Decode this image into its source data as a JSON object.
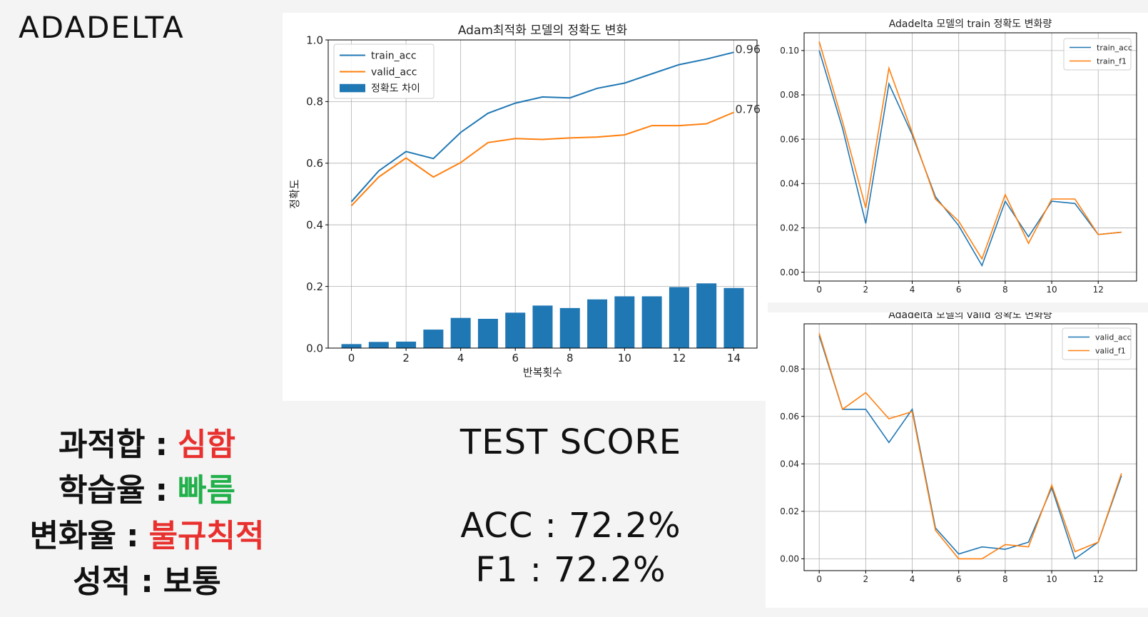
{
  "slide": {
    "title": "ADADELTA"
  },
  "summary": [
    {
      "label": "과적합",
      "value": "심함",
      "color": "#e8312f"
    },
    {
      "label": "학습율",
      "value": "빠름",
      "color": "#22b04b"
    },
    {
      "label": "변화율",
      "value": "불규칙적",
      "color": "#e8312f"
    },
    {
      "label": "성적",
      "value": "보통",
      "color": "#111111"
    }
  ],
  "test_score": {
    "title": "TEST SCORE",
    "acc_label": "ACC",
    "acc_value": "72.2%",
    "f1_label": "F1",
    "f1_value": "72.2%"
  },
  "chart_data": [
    {
      "type": "line",
      "title": "Adam최적화 모델의 정확도 변화",
      "xlabel": "반복횟수",
      "ylabel": "정확도",
      "x": [
        0,
        1,
        2,
        3,
        4,
        5,
        6,
        7,
        8,
        9,
        10,
        11,
        12,
        13,
        14
      ],
      "xticks": [
        0,
        2,
        4,
        6,
        8,
        10,
        12,
        14
      ],
      "yticks": [
        "0.0",
        "0.2",
        "0.4",
        "0.6",
        "0.8",
        "1.0"
      ],
      "ylim": [
        0,
        1.0
      ],
      "grid": true,
      "legend": "top-left",
      "series": [
        {
          "name": "train_acc",
          "kind": "line",
          "color": "#1f77b4",
          "values": [
            0.475,
            0.575,
            0.638,
            0.615,
            0.7,
            0.762,
            0.795,
            0.815,
            0.812,
            0.843,
            0.86,
            0.89,
            0.92,
            0.938,
            0.96
          ]
        },
        {
          "name": "valid_acc",
          "kind": "line",
          "color": "#ff7f0e",
          "values": [
            0.462,
            0.555,
            0.617,
            0.555,
            0.602,
            0.667,
            0.68,
            0.677,
            0.682,
            0.685,
            0.692,
            0.722,
            0.722,
            0.728,
            0.765
          ]
        },
        {
          "name": "정확도 차이",
          "kind": "bar",
          "color": "#1f77b4",
          "values": [
            0.013,
            0.02,
            0.021,
            0.06,
            0.098,
            0.095,
            0.115,
            0.138,
            0.13,
            0.158,
            0.168,
            0.168,
            0.198,
            0.21,
            0.195
          ]
        }
      ],
      "annotations": [
        {
          "text": "0.96",
          "x": 14,
          "y": 0.96
        },
        {
          "text": "0.76",
          "x": 14,
          "y": 0.765
        }
      ]
    },
    {
      "type": "line",
      "title": "Adadelta 모델의 train 정확도 변화량",
      "x": [
        0,
        1,
        2,
        3,
        4,
        5,
        6,
        7,
        8,
        9,
        10,
        11,
        12,
        13
      ],
      "xticks": [
        0,
        2,
        4,
        6,
        8,
        10,
        12
      ],
      "yticks": [
        "0.00",
        "0.02",
        "0.04",
        "0.06",
        "0.08",
        "0.10"
      ],
      "ylim": [
        -0.004,
        0.108
      ],
      "grid": true,
      "legend": "top-right",
      "series": [
        {
          "name": "train_acc",
          "color": "#1f77b4",
          "values": [
            0.1,
            0.065,
            0.022,
            0.085,
            0.062,
            0.034,
            0.021,
            0.003,
            0.032,
            0.016,
            0.032,
            0.031,
            0.017,
            0.018
          ]
        },
        {
          "name": "train_f1",
          "color": "#ff7f0e",
          "values": [
            0.104,
            0.068,
            0.029,
            0.092,
            0.063,
            0.033,
            0.023,
            0.006,
            0.035,
            0.013,
            0.033,
            0.033,
            0.017,
            0.018
          ]
        }
      ]
    },
    {
      "type": "line",
      "title": "Adadelta 모델의 valid 정확도 변화량",
      "x": [
        0,
        1,
        2,
        3,
        4,
        5,
        6,
        7,
        8,
        9,
        10,
        11,
        12,
        13
      ],
      "xticks": [
        0,
        2,
        4,
        6,
        8,
        10,
        12
      ],
      "yticks": [
        "0.00",
        "0.02",
        "0.04",
        "0.06",
        "0.08"
      ],
      "ylim": [
        -0.005,
        0.099
      ],
      "grid": true,
      "legend": "top-right",
      "series": [
        {
          "name": "valid_acc",
          "color": "#1f77b4",
          "values": [
            0.094,
            0.063,
            0.063,
            0.049,
            0.063,
            0.013,
            0.002,
            0.005,
            0.004,
            0.007,
            0.03,
            0.0,
            0.007,
            0.035
          ]
        },
        {
          "name": "valid_f1",
          "color": "#ff7f0e",
          "values": [
            0.095,
            0.063,
            0.07,
            0.059,
            0.062,
            0.012,
            0.0,
            0.0,
            0.006,
            0.005,
            0.031,
            0.003,
            0.007,
            0.036
          ]
        }
      ]
    }
  ]
}
